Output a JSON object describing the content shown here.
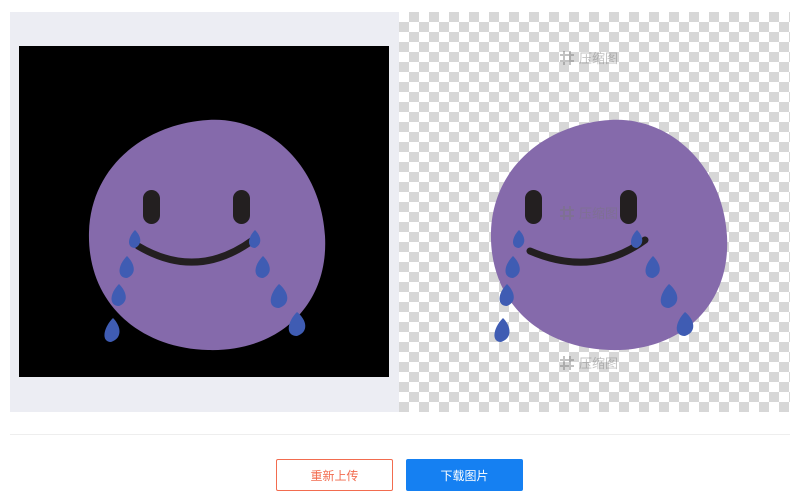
{
  "preview": {
    "watermark_text": "压缩图"
  },
  "actions": {
    "reupload_label": "重新上传",
    "download_label": "下载图片"
  },
  "colors": {
    "face": "#856aab",
    "eye_mouth": "#231f20",
    "tear": "#3f5cb3",
    "reupload_accent": "#f26c4f",
    "download_accent": "#1580f2",
    "original_bg": "#ecedf3"
  },
  "icons": [
    "crying-smile-emoji",
    "watermark-logo-icon"
  ]
}
